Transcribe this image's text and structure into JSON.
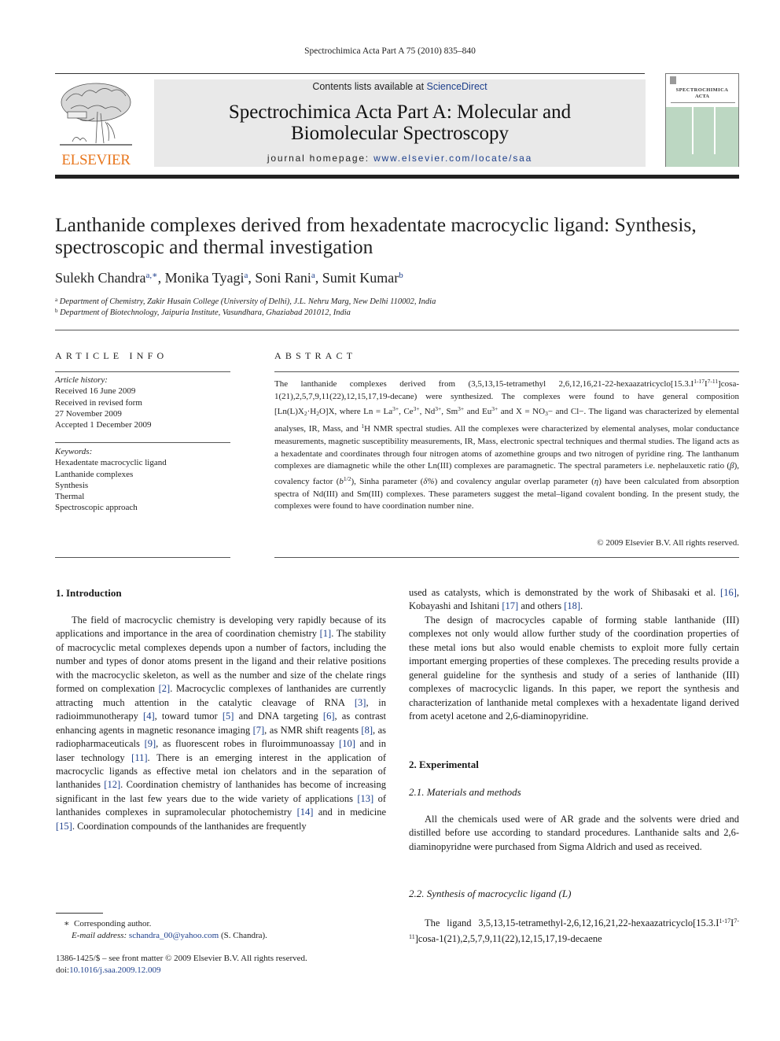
{
  "running_head": "Spectrochimica Acta Part A 75 (2010) 835–840",
  "masthead": {
    "publisher": "ELSEVIER",
    "contents_prefix": "Contents lists available at ",
    "contents_link": "ScienceDirect",
    "journal_title_line1": "Spectrochimica Acta Part A: Molecular and",
    "journal_title_line2": "Biomolecular Spectroscopy",
    "homepage_prefix": "journal homepage: ",
    "homepage_url": "www.elsevier.com/locate/saa",
    "cover_title_line1": "SPECTROCHIMICA",
    "cover_title_line2": "ACTA",
    "cover_color": "#bcd7c2",
    "publisher_color": "#e8771e",
    "link_color": "#1d3f8c"
  },
  "article": {
    "title": "Lanthanide complexes derived from hexadentate macrocyclic ligand: Synthesis, spectroscopic and thermal investigation",
    "authors": [
      {
        "name": "Sulekh Chandra",
        "marks": "a,∗"
      },
      {
        "name": "Monika Tyagi",
        "marks": "a"
      },
      {
        "name": "Soni Rani",
        "marks": "a"
      },
      {
        "name": "Sumit Kumar",
        "marks": "b"
      }
    ],
    "affiliations": [
      {
        "mark": "a",
        "text": "Department of Chemistry, Zakir Husain College (University of Delhi), J.L. Nehru Marg, New Delhi 110002, India"
      },
      {
        "mark": "b",
        "text": "Department of Biotechnology, Jaipuria Institute, Vasundhara, Ghaziabad 201012, India"
      }
    ]
  },
  "article_info": {
    "heading": "ARTICLE INFO",
    "history_label": "Article history:",
    "history": [
      "Received 16 June 2009",
      "Received in revised form",
      "27 November 2009",
      "Accepted 1 December 2009"
    ],
    "keywords_label": "Keywords:",
    "keywords": [
      "Hexadentate macrocyclic ligand",
      "Lanthanide complexes",
      "Synthesis",
      "Thermal",
      "Spectroscopic approach"
    ]
  },
  "abstract": {
    "heading": "ABSTRACT",
    "segments": {
      "s1": "The lanthanide complexes derived from (3,5,13,15-tetramethyl 2,6,12,16,21-22-hexaazatricyclo[15.3.I",
      "sup1": "1-17",
      "s2": "I",
      "sup2": "7-11",
      "s3": "]cosa-1(21),2,5,7,9,11(22),12,15,17,19-decane) were synthesized. The complexes were found to have general composition [Ln(L)X",
      "sub1": "2",
      "s4": "·H",
      "sub2": "2",
      "s5": "O]X, where Ln = La",
      "sup3": "3+",
      "s6": ", Ce",
      "sup4": "3+",
      "s7": ", Nd",
      "sup5": "3+",
      "s8": ", Sm",
      "sup6": "3+",
      "s9": " and Eu",
      "sup7": "3+",
      "s10": " and X = NO",
      "sub3": "3",
      "s11": "− and Cl−. The ligand was characterized by elemental analyses, IR, Mass, and ",
      "sup8": "1",
      "s12": "H NMR spectral studies. All the complexes were characterized by elemental analyses, molar conductance measurements, magnetic susceptibility measurements, IR, Mass, electronic spectral techniques and thermal studies. The ligand acts as a hexadentate and coordinates through four nitrogen atoms of azomethine groups and two nitrogen of pyridine ring. The lanthanum complexes are diamagnetic while the other Ln(III) complexes are paramagnetic. The spectral parameters i.e. nephelauxetic ratio (",
      "beta": "β",
      "s13": "), covalency factor (",
      "b": "b",
      "sup9": "1/2",
      "s14": "), Sinha parameter (",
      "delta": "δ%",
      "s15": ") and covalency angular overlap parameter (",
      "eta": "η",
      "s16": ") have been calculated from absorption spectra of Nd(III) and Sm(III) complexes. These parameters suggest the metal–ligand covalent bonding. In the present study, the complexes were found to have coordination number nine."
    },
    "copyright": "© 2009 Elsevier B.V. All rights reserved."
  },
  "intro": {
    "heading": "1.  Introduction",
    "p1": [
      {
        "t": "The field of macrocyclic chemistry is developing very rapidly because of its applications and importance in the area of coordination chemistry "
      },
      {
        "r": "[1]"
      },
      {
        "t": ". The stability of macrocyclic metal complexes depends upon a number of factors, including the number and types of donor atoms present in the ligand and their relative positions with the macrocyclic skeleton, as well as the number and size of the chelate rings formed on complexation "
      },
      {
        "r": "[2]"
      },
      {
        "t": ". Macrocyclic complexes of lanthanides are currently attracting much attention in the catalytic cleavage of RNA "
      },
      {
        "r": "[3]"
      },
      {
        "t": ", in radioimmunotherapy "
      },
      {
        "r": "[4]"
      },
      {
        "t": ", toward tumor "
      },
      {
        "r": "[5]"
      },
      {
        "t": " and DNA targeting "
      },
      {
        "r": "[6]"
      },
      {
        "t": ", as contrast enhancing agents in magnetic resonance imaging "
      },
      {
        "r": "[7]"
      },
      {
        "t": ", as NMR shift reagents "
      },
      {
        "r": "[8]"
      },
      {
        "t": ", as radiopharmaceuticals "
      },
      {
        "r": "[9]"
      },
      {
        "t": ", as fluorescent robes in fluroimmunoassay "
      },
      {
        "r": "[10]"
      },
      {
        "t": " and in laser technology "
      },
      {
        "r": "[11]"
      },
      {
        "t": ". There is an emerging interest in the application of macrocyclic ligands as effective metal ion chelators and in the separation of lanthanides "
      },
      {
        "r": "[12]"
      },
      {
        "t": ". Coordination chemistry of lanthanides has become of increasing significant in the last few years due to the wide variety of applications "
      },
      {
        "r": "[13]"
      },
      {
        "t": " of lanthanides complexes in supramolecular photochemistry "
      },
      {
        "r": "[14]"
      },
      {
        "t": " and in medicine "
      },
      {
        "r": "[15]"
      },
      {
        "t": ". Coordination compounds of the lanthanides are frequently"
      }
    ],
    "p2": [
      {
        "t": "used as catalysts, which is demonstrated by the work of Shibasaki et al. "
      },
      {
        "r": "[16]"
      },
      {
        "t": ", Kobayashi and Ishitani "
      },
      {
        "r": "[17]"
      },
      {
        "t": " and others "
      },
      {
        "r": "[18]"
      },
      {
        "t": "."
      }
    ],
    "p3": "The design of macrocycles capable of forming stable lanthanide (III) complexes not only would allow further study of the coordination properties of these metal ions but also would enable chemists to exploit more fully certain important emerging properties of these complexes. The preceding results provide a general guideline for the synthesis and study of a series of lanthanide (III) complexes of macrocyclic ligands. In this paper, we report the synthesis and characterization of lanthanide metal complexes with a hexadentate ligand derived from acetyl acetone and 2,6-diaminopyridine."
  },
  "experimental": {
    "heading": "2.  Experimental",
    "sub1_heading": "2.1.  Materials and methods",
    "sub1_body": "All the chemicals used were of AR grade and the solvents were dried and distilled before use according to standard procedures. Lanthanide salts and 2,6-diaminopyridne were purchased from Sigma Aldrich and used as received.",
    "sub2_heading": "2.2.  Synthesis of macrocyclic ligand (L)",
    "sub2_s1": "The ligand 3,5,13,15-tetramethyl-2,6,12,16,21,22-hexaazatricyclo[15.3.I",
    "sub2_sup1": "1-17",
    "sub2_s2": "I",
    "sub2_sup2": "7-11",
    "sub2_s3": "]cosa-1(21),2,5,7,9,11(22),12,15,17,19-decaene"
  },
  "footnotes": {
    "corr_mark": "∗",
    "corr_text": "Corresponding author.",
    "email_label": "E-mail address:",
    "email": "schandra_00@yahoo.com",
    "email_suffix": " (S. Chandra).",
    "issn": "1386-1425/$ – see front matter © 2009 Elsevier B.V. All rights reserved.",
    "doi_prefix": "doi:",
    "doi": "10.1016/j.saa.2009.12.009"
  }
}
